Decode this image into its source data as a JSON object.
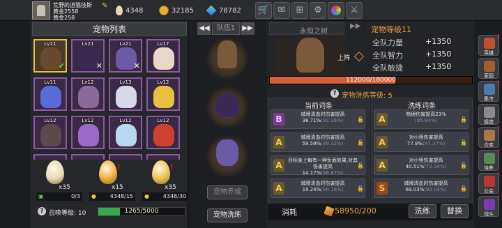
{
  "player": {
    "name": "荒野的逍猫技斯",
    "line2": "黄金2558",
    "line3": "黄金258"
  },
  "resources": [
    {
      "icon": "egg-icon",
      "value": "4348"
    },
    {
      "icon": "gold-coin-icon",
      "value": "32185"
    },
    {
      "icon": "gem-icon",
      "value": "78782"
    }
  ],
  "top_buttons": [
    "shop-icon",
    "mail-icon",
    "gamepad-icon",
    "settings-icon",
    "color-wheel-icon",
    "sword-icon"
  ],
  "left": {
    "title": "宠物列表",
    "pets": [
      {
        "level": "Lv11",
        "color": "#6a4a2a",
        "mark": "check",
        "selected": true
      },
      {
        "level": "Lv21",
        "color": "#3a2a55",
        "mark": "x"
      },
      {
        "level": "Lv21",
        "color": "#6a5aa8",
        "mark": "x"
      },
      {
        "level": "Lv17",
        "color": "#e8d8c8",
        "mark": ""
      },
      {
        "level": "Lv11",
        "color": "#5a6ad8",
        "mark": ""
      },
      {
        "level": "Lv12",
        "color": "#8a6a9a",
        "mark": ""
      },
      {
        "level": "Lv13",
        "color": "#d8d8e8",
        "mark": ""
      },
      {
        "level": "Lv12",
        "color": "#e8c040",
        "mark": ""
      },
      {
        "level": "Lv12",
        "color": "#5a4a4a",
        "mark": ""
      },
      {
        "level": "Lv12",
        "color": "#9a6ac8",
        "mark": ""
      },
      {
        "level": "Lv12",
        "color": "#b8d8f0",
        "mark": ""
      },
      {
        "level": "Lv12",
        "color": "#d04030",
        "mark": ""
      }
    ],
    "eggs": [
      {
        "count": "x35",
        "sub": "0/3",
        "color": "#e8d8b8"
      },
      {
        "count": "x15",
        "sub": "4348/15",
        "color": "#f0a838"
      },
      {
        "count": "x35",
        "sub": "4348/30",
        "color": "#e8c050"
      }
    ],
    "summon_label": "召唤等级:",
    "summon_level": "10",
    "summon_progress": "1265/5000",
    "summon_fraction": 0.253
  },
  "center": {
    "tab": "队伍1",
    "btn_release": "宠物养成",
    "btn_wash": "宠物洗练"
  },
  "right": {
    "tree_name": "永恒之树",
    "pet_level": "宠物等级11",
    "deploy": "上阵",
    "stats": [
      {
        "label": "全队力量",
        "value": "+1350"
      },
      {
        "label": "全队智力",
        "value": "+1350"
      },
      {
        "label": "全队敏捷",
        "value": "+1350"
      }
    ],
    "hp": "112000/180000",
    "hp_fraction": 0.622,
    "wash_level": "宠物洗练等级: 5",
    "current_title": "当前词条",
    "wash_title": "洗练词条",
    "current": [
      {
        "grade": "B",
        "text": "城墙清血时伤害提高",
        "pct": "38.71%",
        "paren": "(92.16%)"
      },
      {
        "grade": "A",
        "text": "城墙清血时伤害提高",
        "pct": "59.59%",
        "paren": "(99.32%)"
      },
      {
        "grade": "A",
        "text": "目标身上每有一种负面效果,对其伤害提高",
        "pct": "14.17%",
        "paren": "(86.87%)"
      },
      {
        "grade": "A",
        "text": "城墙清血时伤害提高",
        "pct": "19.24%",
        "paren": "(80.16%)"
      }
    ],
    "washed": [
      {
        "grade": "A",
        "text": "物理伤害提高23%",
        "pct": "",
        "paren": "(95.84%)"
      },
      {
        "grade": "A",
        "text": "对小怪伤害提高",
        "pct": "77.9%",
        "paren": "(97.37%)"
      },
      {
        "grade": "A",
        "text": "对小怪伤害提高",
        "pct": "40.51%",
        "paren": "(72.34%)"
      },
      {
        "grade": "S",
        "text": "城墙清血时伤害提高",
        "pct": "69.03%",
        "paren": "(92.04%)"
      }
    ],
    "cost_label": "消耗",
    "cost_value": "58950/200",
    "btn_wash": "洗练",
    "btn_replace": "替换"
  },
  "side_menu": [
    {
      "label": "英雄",
      "color": "#c05030",
      "alert": true
    },
    {
      "label": "家园",
      "color": "#a06030",
      "alert": false
    },
    {
      "label": "集市",
      "color": "#4a7ab0",
      "alert": true
    },
    {
      "label": "锻造",
      "color": "#8a8a8a",
      "alert": false
    },
    {
      "label": "仓库",
      "color": "#a87848",
      "alert": true
    },
    {
      "label": "培养",
      "color": "#5a8a50",
      "alert": true
    },
    {
      "label": "公会",
      "color": "#b83830",
      "alert": true
    },
    {
      "label": "战斗",
      "color": "#7a3ab0",
      "alert": true
    }
  ]
}
